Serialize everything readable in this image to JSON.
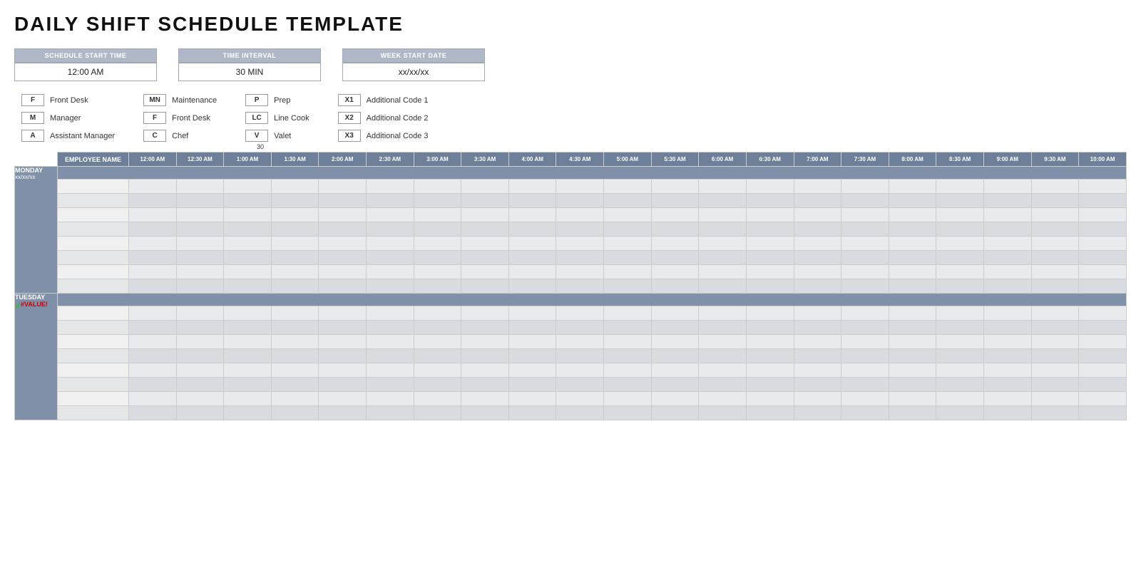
{
  "title": "DAILY SHIFT SCHEDULE TEMPLATE",
  "controls": {
    "schedule_start_time": {
      "label": "SCHEDULE START TIME",
      "value": "12:00 AM"
    },
    "time_interval": {
      "label": "TIME INTERVAL",
      "value": "30 MIN"
    },
    "week_start_date": {
      "label": "WEEK START DATE",
      "value": "xx/xx/xx"
    }
  },
  "legend": [
    [
      {
        "code": "F",
        "desc": "Front Desk"
      },
      {
        "code": "M",
        "desc": "Manager"
      },
      {
        "code": "A",
        "desc": "Assistant Manager"
      }
    ],
    [
      {
        "code": "MN",
        "desc": "Maintenance"
      },
      {
        "code": "F",
        "desc": "Front Desk"
      },
      {
        "code": "C",
        "desc": "Chef"
      }
    ],
    [
      {
        "code": "P",
        "desc": "Prep"
      },
      {
        "code": "LC",
        "desc": "Line Cook"
      },
      {
        "code": "V",
        "desc": "Valet"
      }
    ],
    [
      {
        "code": "X1",
        "desc": "Additional Code 1"
      },
      {
        "code": "X2",
        "desc": "Additional Code 2"
      },
      {
        "code": "X3",
        "desc": "Additional Code 3"
      }
    ]
  ],
  "col_30_label": "30",
  "time_columns": [
    "12:00 AM",
    "12:30 AM",
    "1:00 AM",
    "1:30 AM",
    "2:00 AM",
    "2:30 AM",
    "3:00 AM",
    "3:30 AM",
    "4:00 AM",
    "4:30 AM",
    "5:00 AM",
    "5:30 AM",
    "6:00 AM",
    "6:30 AM",
    "7:00 AM",
    "7:30 AM",
    "8:00 AM",
    "8:30 AM",
    "9:00 AM",
    "9:30 AM",
    "10:00 AM"
  ],
  "employee_name_header": "EMPLOYEE NAME",
  "days": [
    {
      "day": "MONDAY",
      "date": "xx/xx/xx",
      "rows": 8,
      "has_triangle": false,
      "date_error": false
    },
    {
      "day": "TUESDAY",
      "date": "#VALUE!",
      "rows": 8,
      "has_triangle": true,
      "date_error": true
    }
  ]
}
